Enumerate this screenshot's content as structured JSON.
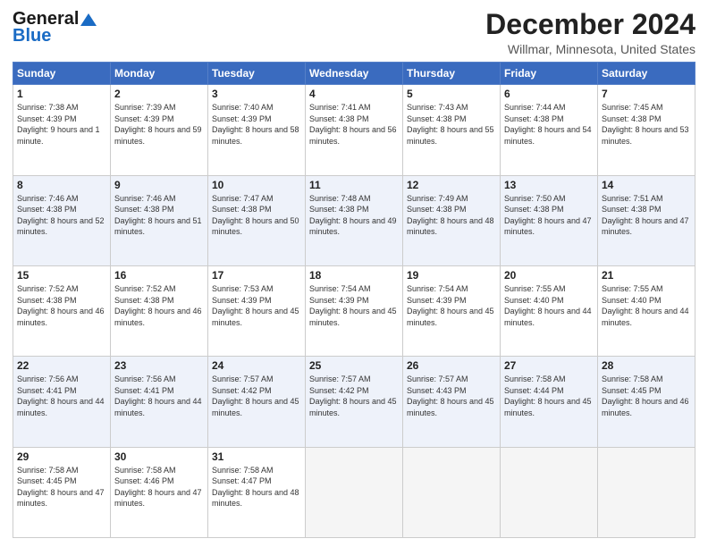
{
  "logo": {
    "line1": "General",
    "line2": "Blue"
  },
  "header": {
    "month": "December 2024",
    "location": "Willmar, Minnesota, United States"
  },
  "weekdays": [
    "Sunday",
    "Monday",
    "Tuesday",
    "Wednesday",
    "Thursday",
    "Friday",
    "Saturday"
  ],
  "weeks": [
    [
      {
        "day": 1,
        "sunrise": "7:38 AM",
        "sunset": "4:39 PM",
        "daylight": "9 hours and 1 minute."
      },
      {
        "day": 2,
        "sunrise": "7:39 AM",
        "sunset": "4:39 PM",
        "daylight": "8 hours and 59 minutes."
      },
      {
        "day": 3,
        "sunrise": "7:40 AM",
        "sunset": "4:39 PM",
        "daylight": "8 hours and 58 minutes."
      },
      {
        "day": 4,
        "sunrise": "7:41 AM",
        "sunset": "4:38 PM",
        "daylight": "8 hours and 56 minutes."
      },
      {
        "day": 5,
        "sunrise": "7:43 AM",
        "sunset": "4:38 PM",
        "daylight": "8 hours and 55 minutes."
      },
      {
        "day": 6,
        "sunrise": "7:44 AM",
        "sunset": "4:38 PM",
        "daylight": "8 hours and 54 minutes."
      },
      {
        "day": 7,
        "sunrise": "7:45 AM",
        "sunset": "4:38 PM",
        "daylight": "8 hours and 53 minutes."
      }
    ],
    [
      {
        "day": 8,
        "sunrise": "7:46 AM",
        "sunset": "4:38 PM",
        "daylight": "8 hours and 52 minutes."
      },
      {
        "day": 9,
        "sunrise": "7:46 AM",
        "sunset": "4:38 PM",
        "daylight": "8 hours and 51 minutes."
      },
      {
        "day": 10,
        "sunrise": "7:47 AM",
        "sunset": "4:38 PM",
        "daylight": "8 hours and 50 minutes."
      },
      {
        "day": 11,
        "sunrise": "7:48 AM",
        "sunset": "4:38 PM",
        "daylight": "8 hours and 49 minutes."
      },
      {
        "day": 12,
        "sunrise": "7:49 AM",
        "sunset": "4:38 PM",
        "daylight": "8 hours and 48 minutes."
      },
      {
        "day": 13,
        "sunrise": "7:50 AM",
        "sunset": "4:38 PM",
        "daylight": "8 hours and 47 minutes."
      },
      {
        "day": 14,
        "sunrise": "7:51 AM",
        "sunset": "4:38 PM",
        "daylight": "8 hours and 47 minutes."
      }
    ],
    [
      {
        "day": 15,
        "sunrise": "7:52 AM",
        "sunset": "4:38 PM",
        "daylight": "8 hours and 46 minutes."
      },
      {
        "day": 16,
        "sunrise": "7:52 AM",
        "sunset": "4:38 PM",
        "daylight": "8 hours and 46 minutes."
      },
      {
        "day": 17,
        "sunrise": "7:53 AM",
        "sunset": "4:39 PM",
        "daylight": "8 hours and 45 minutes."
      },
      {
        "day": 18,
        "sunrise": "7:54 AM",
        "sunset": "4:39 PM",
        "daylight": "8 hours and 45 minutes."
      },
      {
        "day": 19,
        "sunrise": "7:54 AM",
        "sunset": "4:39 PM",
        "daylight": "8 hours and 45 minutes."
      },
      {
        "day": 20,
        "sunrise": "7:55 AM",
        "sunset": "4:40 PM",
        "daylight": "8 hours and 44 minutes."
      },
      {
        "day": 21,
        "sunrise": "7:55 AM",
        "sunset": "4:40 PM",
        "daylight": "8 hours and 44 minutes."
      }
    ],
    [
      {
        "day": 22,
        "sunrise": "7:56 AM",
        "sunset": "4:41 PM",
        "daylight": "8 hours and 44 minutes."
      },
      {
        "day": 23,
        "sunrise": "7:56 AM",
        "sunset": "4:41 PM",
        "daylight": "8 hours and 44 minutes."
      },
      {
        "day": 24,
        "sunrise": "7:57 AM",
        "sunset": "4:42 PM",
        "daylight": "8 hours and 45 minutes."
      },
      {
        "day": 25,
        "sunrise": "7:57 AM",
        "sunset": "4:42 PM",
        "daylight": "8 hours and 45 minutes."
      },
      {
        "day": 26,
        "sunrise": "7:57 AM",
        "sunset": "4:43 PM",
        "daylight": "8 hours and 45 minutes."
      },
      {
        "day": 27,
        "sunrise": "7:58 AM",
        "sunset": "4:44 PM",
        "daylight": "8 hours and 45 minutes."
      },
      {
        "day": 28,
        "sunrise": "7:58 AM",
        "sunset": "4:45 PM",
        "daylight": "8 hours and 46 minutes."
      }
    ],
    [
      {
        "day": 29,
        "sunrise": "7:58 AM",
        "sunset": "4:45 PM",
        "daylight": "8 hours and 47 minutes."
      },
      {
        "day": 30,
        "sunrise": "7:58 AM",
        "sunset": "4:46 PM",
        "daylight": "8 hours and 47 minutes."
      },
      {
        "day": 31,
        "sunrise": "7:58 AM",
        "sunset": "4:47 PM",
        "daylight": "8 hours and 48 minutes."
      },
      null,
      null,
      null,
      null
    ]
  ],
  "labels": {
    "sunrise": "Sunrise:",
    "sunset": "Sunset:",
    "daylight": "Daylight:"
  }
}
